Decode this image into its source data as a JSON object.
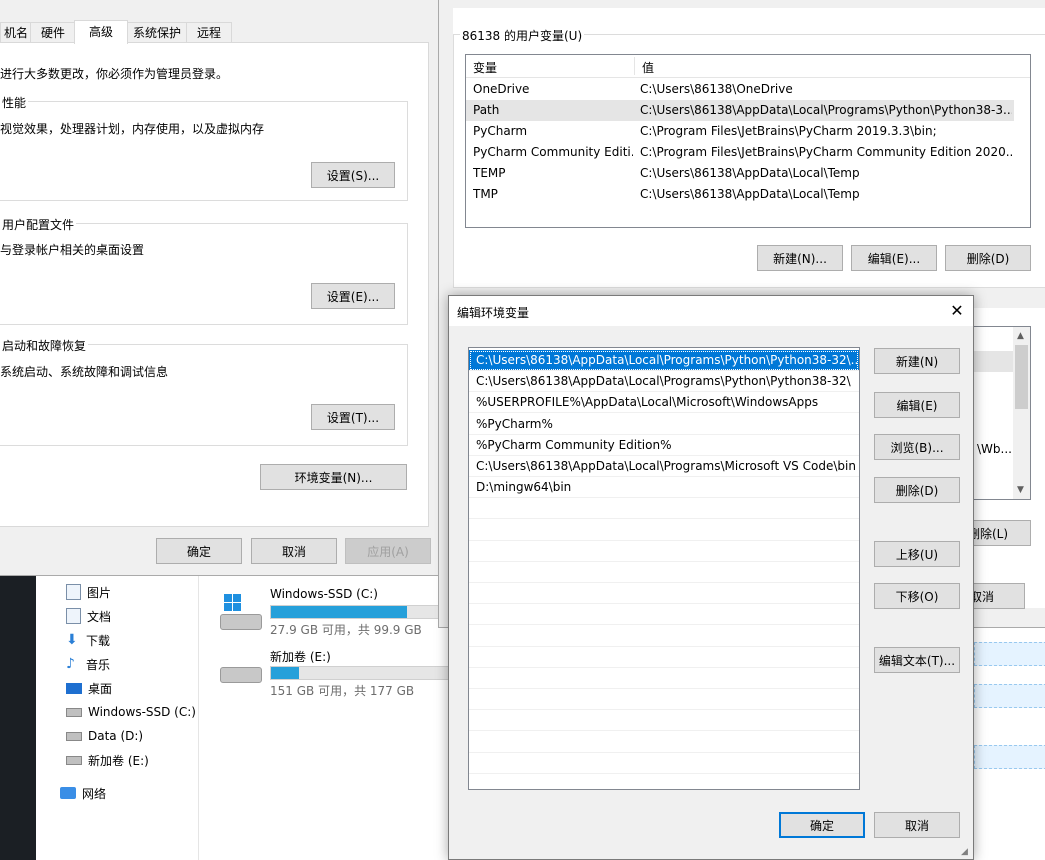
{
  "sysprops": {
    "tabs": [
      "机名",
      "硬件",
      "高级",
      "系统保护",
      "远程"
    ],
    "admin_note": "进行大多数更改，你必须作为管理员登录。",
    "perf_title": "性能",
    "perf_desc": "视觉效果，处理器计划，内存使用，以及虚拟内存",
    "perf_btn": "设置(S)...",
    "profile_title": "用户配置文件",
    "profile_desc": "与登录帐户相关的桌面设置",
    "profile_btn": "设置(E)...",
    "startup_title": "启动和故障恢复",
    "startup_desc": "系统启动、系统故障和调试信息",
    "startup_btn": "设置(T)...",
    "env_btn": "环境变量(N)...",
    "ok": "确定",
    "cancel": "取消",
    "apply": "应用(A)"
  },
  "explorer": {
    "nav": [
      {
        "label": "图片",
        "icon": "pictures-icon"
      },
      {
        "label": "文档",
        "icon": "documents-icon"
      },
      {
        "label": "下载",
        "icon": "download-icon"
      },
      {
        "label": "音乐",
        "icon": "music-icon"
      },
      {
        "label": "桌面",
        "icon": "desktop-icon"
      },
      {
        "label": "Windows-SSD (C:)",
        "icon": "drive-icon"
      },
      {
        "label": "Data (D:)",
        "icon": "drive-icon"
      },
      {
        "label": "新加卷 (E:)",
        "icon": "drive-icon"
      }
    ],
    "network": "网络",
    "drives": [
      {
        "name": "Windows-SSD (C:)",
        "free": "27.9 GB 可用，共 99.9 GB",
        "used_fraction": 0.72
      },
      {
        "name": "新加卷 (E:)",
        "free": "151 GB 可用，共 177 GB",
        "used_fraction": 0.15
      }
    ]
  },
  "envvars": {
    "user_group_title": "86138 的用户变量(U)",
    "col_var": "变量",
    "col_val": "值",
    "user_vars": [
      {
        "name": "OneDrive",
        "value": "C:\\Users\\86138\\OneDrive"
      },
      {
        "name": "Path",
        "value": "C:\\Users\\86138\\AppData\\Local\\Programs\\Python\\Python38-3..."
      },
      {
        "name": "PyCharm",
        "value": "C:\\Program Files\\JetBrains\\PyCharm 2019.3.3\\bin;"
      },
      {
        "name": "PyCharm Community Editi...",
        "value": "C:\\Program Files\\JetBrains\\PyCharm Community Edition 2020...."
      },
      {
        "name": "TEMP",
        "value": "C:\\Users\\86138\\AppData\\Local\\Temp"
      },
      {
        "name": "TMP",
        "value": "C:\\Users\\86138\\AppData\\Local\\Temp"
      }
    ],
    "new": "新建(N)...",
    "edit": "编辑(E)...",
    "delete": "删除(D)",
    "partial_text": "\\Wb...",
    "partial_delete": "删除(L)",
    "partial_cancel": "取消"
  },
  "editenv": {
    "title": "编辑环境变量",
    "entries": [
      "C:\\Users\\86138\\AppData\\Local\\Programs\\Python\\Python38-32\\...",
      "C:\\Users\\86138\\AppData\\Local\\Programs\\Python\\Python38-32\\",
      "%USERPROFILE%\\AppData\\Local\\Microsoft\\WindowsApps",
      "%PyCharm%",
      "%PyCharm Community Edition%",
      "C:\\Users\\86138\\AppData\\Local\\Programs\\Microsoft VS Code\\bin",
      "D:\\mingw64\\bin"
    ],
    "new": "新建(N)",
    "edit": "编辑(E)",
    "browse": "浏览(B)...",
    "delete": "删除(D)",
    "move_up": "上移(U)",
    "move_down": "下移(O)",
    "edit_text": "编辑文本(T)...",
    "ok": "确定",
    "cancel": "取消"
  }
}
